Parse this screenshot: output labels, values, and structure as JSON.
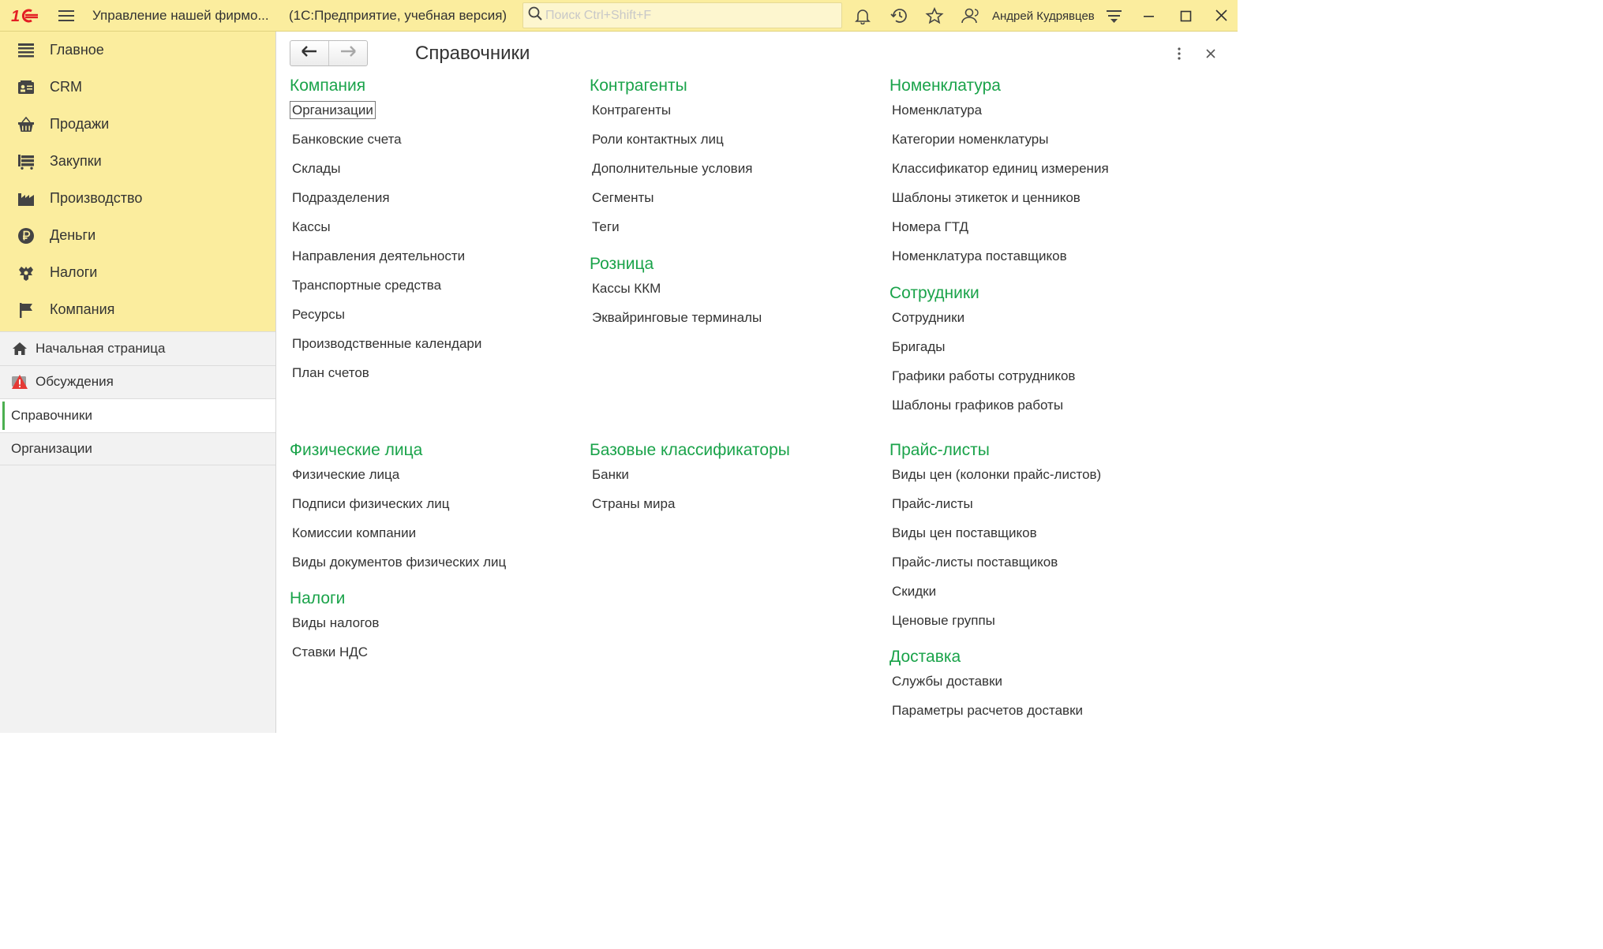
{
  "titlebar": {
    "app_title": "Управление нашей фирмо...",
    "app_subtitle": "(1С:Предприятие, учебная версия)",
    "search_placeholder": "Поиск Ctrl+Shift+F",
    "user_name": "Андрей Кудрявцев",
    "icons": [
      "logo-1c-icon",
      "hamburger-menu-icon",
      "search-icon",
      "bell-icon",
      "history-icon",
      "star-icon",
      "user-icon",
      "settings-menu-icon",
      "minimize-icon",
      "maximize-icon",
      "close-icon"
    ]
  },
  "sidebar": {
    "sections": [
      {
        "label": "Главное",
        "icon": "list-lines-icon"
      },
      {
        "label": "CRM",
        "icon": "crm-card-icon"
      },
      {
        "label": "Продажи",
        "icon": "basket-icon"
      },
      {
        "label": "Закупки",
        "icon": "cart-icon"
      },
      {
        "label": "Производство",
        "icon": "factory-icon"
      },
      {
        "label": "Деньги",
        "icon": "ruble-icon"
      },
      {
        "label": "Налоги",
        "icon": "eagle-emblem-icon"
      },
      {
        "label": "Компания",
        "icon": "flag-icon"
      }
    ],
    "open_windows": [
      {
        "label": "Начальная страница",
        "icon": "home-icon"
      },
      {
        "label": "Обсуждения",
        "icon": "discussion-alert-icon"
      },
      {
        "label": "Справочники",
        "active": true
      },
      {
        "label": "Организации"
      }
    ]
  },
  "content": {
    "page_title": "Справочники",
    "groups": [
      {
        "title": "Компания",
        "links": [
          "Организации",
          "Банковские счета",
          "Склады",
          "Подразделения",
          "Кассы",
          "Направления деятельности",
          "Транспортные средства",
          "Ресурсы",
          "Производственные календари",
          "План счетов"
        ]
      },
      {
        "title": "Контрагенты",
        "links": [
          "Контрагенты",
          "Роли контактных лиц",
          "Дополнительные условия",
          "Сегменты",
          "Теги"
        ]
      },
      {
        "title": "Розница",
        "links": [
          "Кассы ККМ",
          "Эквайринговые терминалы"
        ]
      },
      {
        "title": "Номенклатура",
        "links": [
          "Номенклатура",
          "Категории номенклатуры",
          "Классификатор единиц измерения",
          "Шаблоны этикеток и ценников",
          "Номера ГТД",
          "Номенклатура поставщиков"
        ]
      },
      {
        "title": "Сотрудники",
        "links": [
          "Сотрудники",
          "Бригады",
          "Графики работы сотрудников",
          "Шаблоны графиков работы"
        ]
      },
      {
        "title": "Физические лица",
        "links": [
          "Физические лица",
          "Подписи физических лиц",
          "Комиссии компании",
          "Виды документов физических лиц"
        ]
      },
      {
        "title": "Налоги",
        "links": [
          "Виды налогов",
          "Ставки НДС"
        ]
      },
      {
        "title": "Базовые классификаторы",
        "links": [
          "Банки",
          "Страны мира"
        ]
      },
      {
        "title": "Прайс-листы",
        "links": [
          "Виды цен (колонки прайс-листов)",
          "Прайс-листы",
          "Виды цен поставщиков",
          "Прайс-листы поставщиков",
          "Скидки",
          "Ценовые группы"
        ]
      },
      {
        "title": "Доставка",
        "links": [
          "Службы доставки",
          "Параметры расчетов доставки"
        ]
      }
    ]
  },
  "colors": {
    "header_bg": "#fbed9e",
    "group_title": "#1aa34a",
    "logo_red": "#e31e24",
    "active_marker": "#4caf50"
  }
}
